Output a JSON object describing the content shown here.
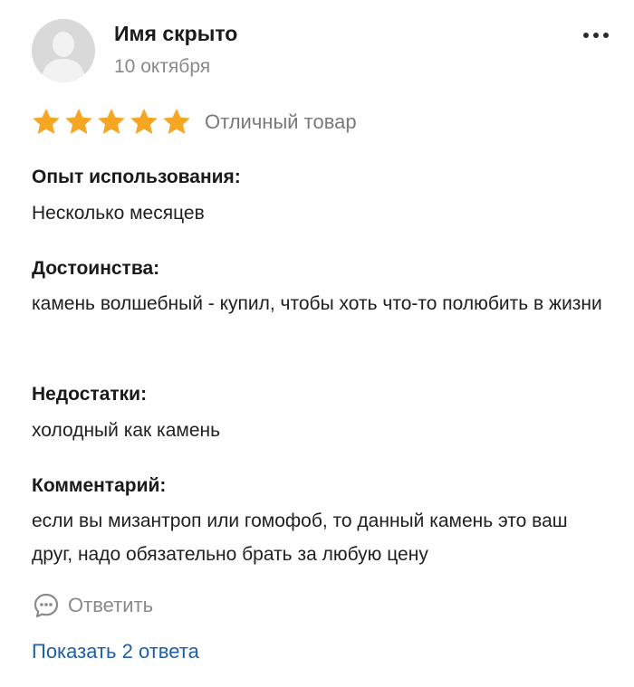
{
  "author": {
    "name": "Имя скрыто",
    "date": "10 октября"
  },
  "rating": {
    "stars": 5,
    "max": 5,
    "label": "Отличный товар",
    "color": "#f5a623"
  },
  "sections": [
    {
      "title": "Опыт использования:",
      "text": "Несколько месяцев"
    },
    {
      "title": "Достоинства:",
      "text": "камень волшебный - купил, чтобы хоть что-то полюбить в жизни"
    },
    {
      "title": "Недостатки:",
      "text": "холодный как камень"
    },
    {
      "title": "Комментарий:",
      "text": "если вы мизантроп или гомофоб, то данный камень это ваш друг, надо обязательно брать за любую цену"
    }
  ],
  "actions": {
    "reply_label": "Ответить",
    "show_answers_label": "Показать 2 ответа"
  },
  "icons": {
    "avatar": "user-silhouette-icon",
    "more": "more-dots-icon",
    "reply": "chat-bubble-icon",
    "star": "star-icon"
  },
  "colors": {
    "link": "#1f5fa6",
    "muted": "#8a8a8a",
    "star": "#f5a623"
  }
}
